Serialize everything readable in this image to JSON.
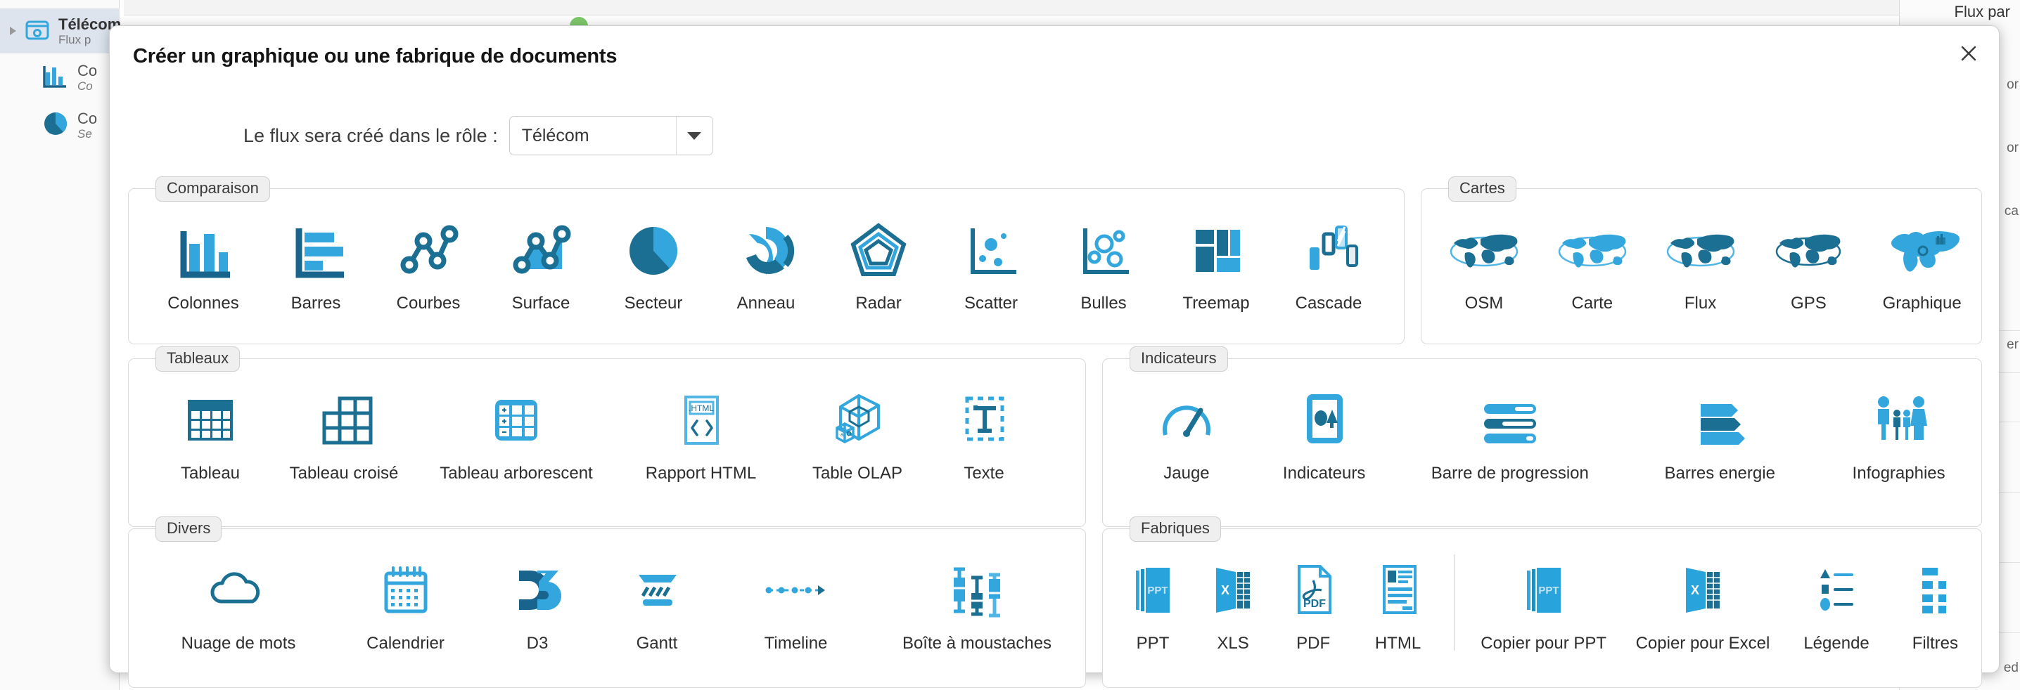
{
  "background": {
    "tree": [
      {
        "title": "Télécom",
        "subtitle": "Flux p",
        "selected": true,
        "icon": "folder-icon"
      },
      {
        "title": "Co",
        "subtitle": "Co",
        "selected": false,
        "icon": "bar-chart-icon"
      },
      {
        "title": "Co",
        "subtitle": "Se",
        "selected": false,
        "icon": "pie-chart-icon"
      }
    ],
    "right_panel": {
      "title": "Flux par",
      "fragments": [
        "or",
        "or",
        "ca",
        "er",
        "ed"
      ]
    }
  },
  "modal": {
    "title": "Créer un graphique ou une fabrique de documents",
    "close_label": "×",
    "role": {
      "label": "Le flux sera créé dans le rôle :",
      "value": "Télécom",
      "options": [
        "Télécom"
      ]
    },
    "sections": [
      {
        "key": "comparaison",
        "legend": "Comparaison",
        "items": [
          {
            "label": "Colonnes",
            "icon": "column-chart-icon"
          },
          {
            "label": "Barres",
            "icon": "bar-chart-icon"
          },
          {
            "label": "Courbes",
            "icon": "line-chart-icon"
          },
          {
            "label": "Surface",
            "icon": "area-chart-icon"
          },
          {
            "label": "Secteur",
            "icon": "pie-chart-icon"
          },
          {
            "label": "Anneau",
            "icon": "donut-chart-icon"
          },
          {
            "label": "Radar",
            "icon": "radar-chart-icon"
          },
          {
            "label": "Scatter",
            "icon": "scatter-chart-icon"
          },
          {
            "label": "Bulles",
            "icon": "bubble-chart-icon"
          },
          {
            "label": "Treemap",
            "icon": "treemap-icon"
          },
          {
            "label": "Cascade",
            "icon": "waterfall-chart-icon"
          }
        ]
      },
      {
        "key": "cartes",
        "legend": "Cartes",
        "items": [
          {
            "label": "OSM",
            "icon": "world-map-icon"
          },
          {
            "label": "Carte",
            "icon": "world-map-light-icon"
          },
          {
            "label": "Flux",
            "icon": "world-map-flow-icon"
          },
          {
            "label": "GPS",
            "icon": "world-map-gps-icon"
          },
          {
            "label": "Graphique",
            "icon": "world-map-chart-icon"
          }
        ]
      },
      {
        "key": "tableaux",
        "legend": "Tableaux",
        "items": [
          {
            "label": "Tableau",
            "icon": "table-icon"
          },
          {
            "label": "Tableau croisé",
            "icon": "pivot-table-icon"
          },
          {
            "label": "Tableau arborescent",
            "icon": "tree-table-icon"
          },
          {
            "label": "Rapport HTML",
            "icon": "html-report-icon"
          },
          {
            "label": "Table OLAP",
            "icon": "olap-cube-icon"
          },
          {
            "label": "Texte",
            "icon": "text-box-icon"
          }
        ]
      },
      {
        "key": "indicateurs",
        "legend": "Indicateurs",
        "items": [
          {
            "label": "Jauge",
            "icon": "gauge-icon"
          },
          {
            "label": "Indicateurs",
            "icon": "kpi-card-icon"
          },
          {
            "label": "Barre de progression",
            "icon": "progress-bar-icon"
          },
          {
            "label": "Barres energie",
            "icon": "energy-bars-icon"
          },
          {
            "label": "Infographies",
            "icon": "infographics-people-icon"
          }
        ]
      },
      {
        "key": "divers",
        "legend": "Divers",
        "items": [
          {
            "label": "Nuage de mots",
            "icon": "word-cloud-icon"
          },
          {
            "label": "Calendrier",
            "icon": "calendar-icon"
          },
          {
            "label": "D3",
            "icon": "d3-logo-icon"
          },
          {
            "label": "Gantt",
            "icon": "gantt-chart-icon"
          },
          {
            "label": "Timeline",
            "icon": "timeline-icon"
          },
          {
            "label": "Boîte à moustaches",
            "icon": "boxplot-icon"
          }
        ]
      },
      {
        "key": "fabriques",
        "legend": "Fabriques",
        "items": [
          {
            "label": "PPT",
            "icon": "ppt-file-icon"
          },
          {
            "label": "XLS",
            "icon": "xls-file-icon"
          },
          {
            "label": "PDF",
            "icon": "pdf-file-icon"
          },
          {
            "label": "HTML",
            "icon": "html-file-icon"
          },
          {
            "label": "Copier pour PPT",
            "icon": "copy-ppt-icon",
            "divider_before": true
          },
          {
            "label": "Copier pour Excel",
            "icon": "copy-excel-icon"
          },
          {
            "label": "Légende",
            "icon": "legend-icon"
          },
          {
            "label": "Filtres",
            "icon": "filters-icon"
          }
        ]
      }
    ]
  },
  "colors": {
    "accent_light": "#27a5dd",
    "accent_dark": "#14688f",
    "legend_bg": "#efefef",
    "modal_bg": "#ffffff",
    "text": "#2e2e2e"
  }
}
